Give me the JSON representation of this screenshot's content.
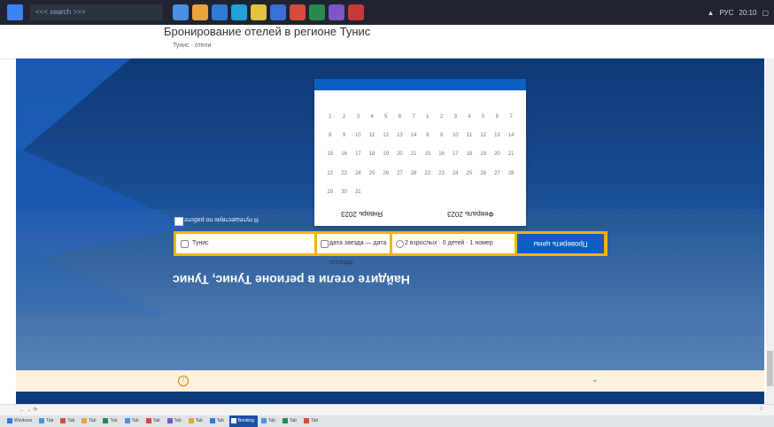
{
  "taskbar": {
    "search_text": "<<< search >>>",
    "icons": [
      {
        "name": "app-icon-1",
        "color": "#4a90e2"
      },
      {
        "name": "app-icon-2",
        "color": "#e8a33d"
      },
      {
        "name": "app-icon-3",
        "color": "#2f7ad8"
      },
      {
        "name": "app-icon-4",
        "color": "#1fa1d9"
      },
      {
        "name": "app-icon-5",
        "color": "#e1c340"
      },
      {
        "name": "app-icon-6",
        "color": "#3b6fd8"
      },
      {
        "name": "app-icon-7",
        "color": "#d84b3b"
      },
      {
        "name": "app-icon-8",
        "color": "#2b8a4b"
      },
      {
        "name": "app-icon-9",
        "color": "#7d56c7"
      },
      {
        "name": "app-icon-10",
        "color": "#c83a3a"
      }
    ],
    "tray_time": "20:10",
    "tray_lang": "РУС"
  },
  "header": {
    "title": "Бронирование отелей в регионе Тунис",
    "meta": "Тунис · отели",
    "right_text": ""
  },
  "calendar": {
    "header_text": "",
    "subheader": "",
    "month_left": "Январь 2023",
    "month_right": "Февраль 2023",
    "days": [
      "1",
      "2",
      "3",
      "4",
      "5",
      "6",
      "7",
      "1",
      "2",
      "3",
      "4",
      "5",
      "6",
      "7",
      "8",
      "9",
      "10",
      "11",
      "12",
      "13",
      "14",
      "8",
      "9",
      "10",
      "11",
      "12",
      "13",
      "14",
      "15",
      "16",
      "17",
      "18",
      "19",
      "20",
      "21",
      "15",
      "16",
      "17",
      "18",
      "19",
      "20",
      "21",
      "22",
      "23",
      "24",
      "25",
      "26",
      "27",
      "28",
      "22",
      "23",
      "24",
      "25",
      "26",
      "27",
      "28",
      "29",
      "30",
      "31",
      "",
      "",
      "",
      "",
      "",
      "",
      "",
      "",
      "",
      "",
      ""
    ]
  },
  "search": {
    "checkbox_label": "Я путешествую по работе",
    "destination": "Тунис",
    "dates": "дата заезда — дата отъезда",
    "guests": "2 взрослых · 0 детей · 1 номер",
    "submit": "Проверить цены"
  },
  "hero": {
    "subtitle": "",
    "headline": "Найдите отели в регионе Тунис, Тунис"
  },
  "notice": {
    "icon": "!",
    "text": "",
    "chevron": "⌄"
  },
  "browser": {
    "nav": "← → ⟳",
    "url": "",
    "right": "☆"
  },
  "tabs": [
    {
      "label": "Windows",
      "color": "#2c7be5",
      "active": false
    },
    {
      "label": "Tab",
      "color": "#4a90e2",
      "active": false
    },
    {
      "label": "Tab",
      "color": "#d84b3b",
      "active": false
    },
    {
      "label": "Tab",
      "color": "#e8a33d",
      "active": false
    },
    {
      "label": "Tab",
      "color": "#2b8a4b",
      "active": false
    },
    {
      "label": "Tab",
      "color": "#4a90e2",
      "active": false
    },
    {
      "label": "Tab",
      "color": "#d84b3b",
      "active": false
    },
    {
      "label": "Tab",
      "color": "#7d56c7",
      "active": false
    },
    {
      "label": "Tab",
      "color": "#e8a33d",
      "active": false
    },
    {
      "label": "Tab",
      "color": "#2c7be5",
      "active": false
    },
    {
      "label": "Booking",
      "color": "#ffffff",
      "active": true
    },
    {
      "label": "Tab",
      "color": "#4a90e2",
      "active": false
    },
    {
      "label": "Tab",
      "color": "#2b8a4b",
      "active": false
    },
    {
      "label": "Tab",
      "color": "#d84b3b",
      "active": false
    }
  ]
}
